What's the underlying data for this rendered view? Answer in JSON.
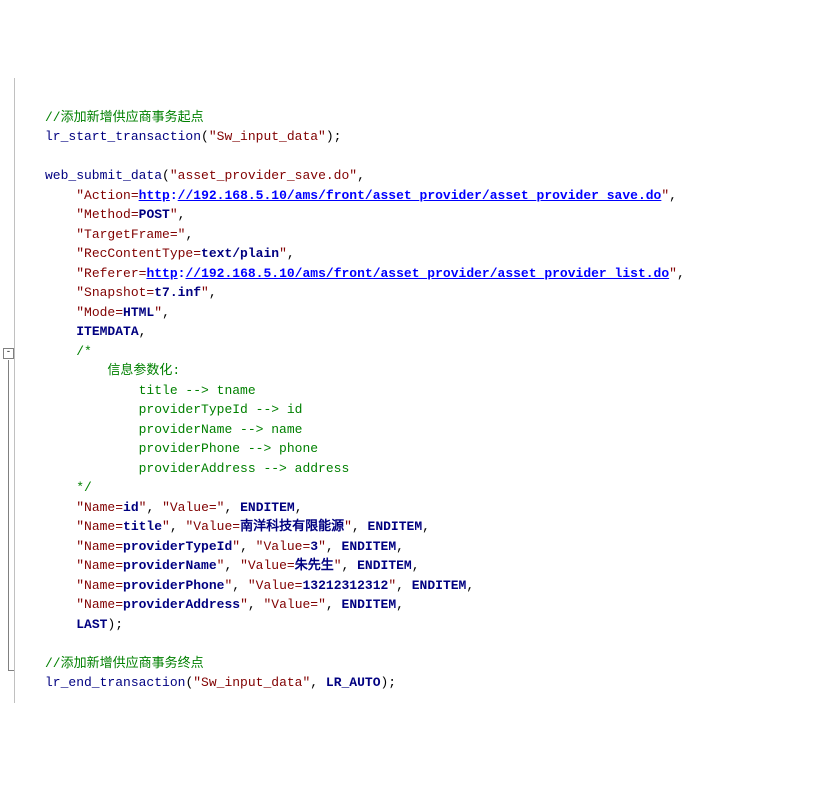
{
  "l01_comment": "//添加新增供应商事务起点",
  "l02_func": "lr_start_transaction",
  "l02_p": "(",
  "l02_str": "\"Sw_input_data\"",
  "l02_end": ");",
  "l04_func": "web_submit_data",
  "l04_p": "(",
  "l04_str": "\"asset_provider_save.do\"",
  "l04_c": ",",
  "l05_str1": "\"Action=",
  "l05_url_a": "http",
  "l05_colon1": ":",
  "l05_url_b": "//192.168.5.10/ams/front/asset_provider/asset_provider_save.do",
  "l05_str2": "\"",
  "l05_c": ",",
  "l06_str1": "\"Method=",
  "l06_kw": "POST",
  "l06_str2": "\"",
  "l06_c": ",",
  "l07_str": "\"TargetFrame=\"",
  "l07_c": ",",
  "l08_str1": "\"RecContentType=",
  "l08_kw": "text/plain",
  "l08_str2": "\"",
  "l08_c": ",",
  "l09_str1": "\"Referer=",
  "l09_url_a": "http",
  "l09_colon1": ":",
  "l09_url_b": "//192.168.5.10/ams/front/asset_provider/asset_provider_list.do",
  "l09_str2": "\"",
  "l09_c": ",",
  "l10_str1": "\"Snapshot=",
  "l10_kw": "t7.inf",
  "l10_str2": "\"",
  "l10_c": ",",
  "l11_str1": "\"Mode=",
  "l11_kw": "HTML",
  "l11_str2": "\"",
  "l11_c": ",",
  "l12_kw": "ITEMDATA",
  "l12_c": ",",
  "l13": "/*",
  "l14": "    信息参数化:",
  "l15": "        title --> tname",
  "l16": "        providerTypeId --> id",
  "l17": "        providerName --> name",
  "l18": "        providerPhone --> phone",
  "l19": "        providerAddress --> address",
  "l20": "*/",
  "l21_s1": "\"Name=",
  "l21_k1": "id",
  "l21_s2": "\"",
  "l21_c1": ", ",
  "l21_s3": "\"Value=\"",
  "l21_c2": ", ",
  "l21_k2": "ENDITEM",
  "l21_c3": ",",
  "l22_s1": "\"Name=",
  "l22_k1": "title",
  "l22_s2": "\"",
  "l22_c1": ", ",
  "l22_s3": "\"Value=",
  "l22_k2": "南洋科技有限能源",
  "l22_s4": "\"",
  "l22_c2": ", ",
  "l22_k3": "ENDITEM",
  "l22_c3": ",",
  "l23_s1": "\"Name=",
  "l23_k1": "providerTypeId",
  "l23_s2": "\"",
  "l23_c1": ", ",
  "l23_s3": "\"Value=",
  "l23_k2": "3",
  "l23_s4": "\"",
  "l23_c2": ", ",
  "l23_k3": "ENDITEM",
  "l23_c3": ",",
  "l24_s1": "\"Name=",
  "l24_k1": "providerName",
  "l24_s2": "\"",
  "l24_c1": ", ",
  "l24_s3": "\"Value=",
  "l24_k2": "朱先生",
  "l24_s4": "\"",
  "l24_c2": ", ",
  "l24_k3": "ENDITEM",
  "l24_c3": ",",
  "l25_s1": "\"Name=",
  "l25_k1": "providerPhone",
  "l25_s2": "\"",
  "l25_c1": ", ",
  "l25_s3": "\"Value=",
  "l25_k2": "13212312312",
  "l25_s4": "\"",
  "l25_c2": ", ",
  "l25_k3": "ENDITEM",
  "l25_c3": ",",
  "l26_s1": "\"Name=",
  "l26_k1": "providerAddress",
  "l26_s2": "\"",
  "l26_c1": ", ",
  "l26_s3": "\"Value=\"",
  "l26_c2": ", ",
  "l26_k2": "ENDITEM",
  "l26_c3": ",",
  "l27_kw": "LAST",
  "l27_end": ");",
  "l29_comment": "//添加新增供应商事务终点",
  "l30_func": "lr_end_transaction",
  "l30_p": "(",
  "l30_str": "\"Sw_input_data\"",
  "l30_c": ", ",
  "l30_kw": "LR_AUTO",
  "l30_end": ");"
}
